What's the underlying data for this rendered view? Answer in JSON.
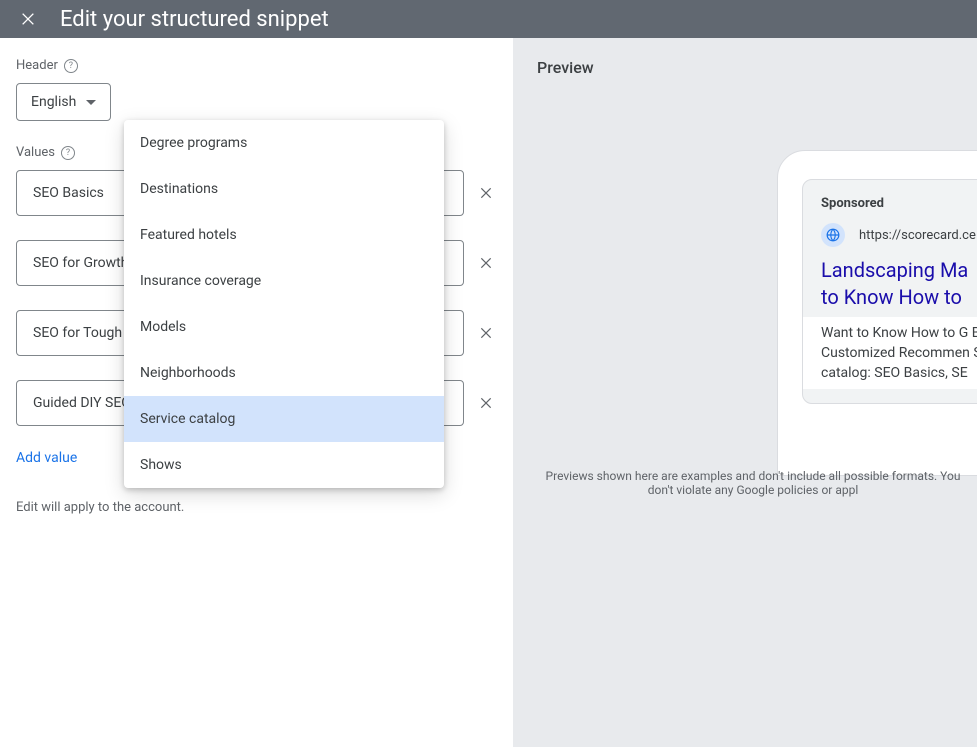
{
  "topbar": {
    "title": "Edit your structured snippet"
  },
  "header": {
    "label": "Header",
    "language": "English"
  },
  "values": {
    "label": "Values",
    "items": [
      {
        "text": "SEO Basics"
      },
      {
        "text": "SEO for Growth"
      },
      {
        "text": "SEO for Tough"
      },
      {
        "text": "Guided DIY SEO"
      }
    ],
    "add_label": "Add value",
    "note": "Edit will apply to the account."
  },
  "dropdown": {
    "options": [
      "Degree programs",
      "Destinations",
      "Featured hotels",
      "Insurance coverage",
      "Models",
      "Neighborhoods",
      "Service catalog",
      "Shows"
    ],
    "selected_index": 6
  },
  "preview": {
    "title": "Preview",
    "sponsored": "Sponsored",
    "url": "https://scorecard.ce",
    "headline_line1": "Landscaping Ma",
    "headline_line2": "to Know How to ",
    "body": "Want to Know How to G Business? Take Our Fre Customized Recommen Scorecard for Landscap catalog: SEO Basics, SE",
    "disclaimer_line1": "Previews shown here are examples and don't include all possible formats. You",
    "disclaimer_line2": "don't violate any Google policies or appl"
  }
}
